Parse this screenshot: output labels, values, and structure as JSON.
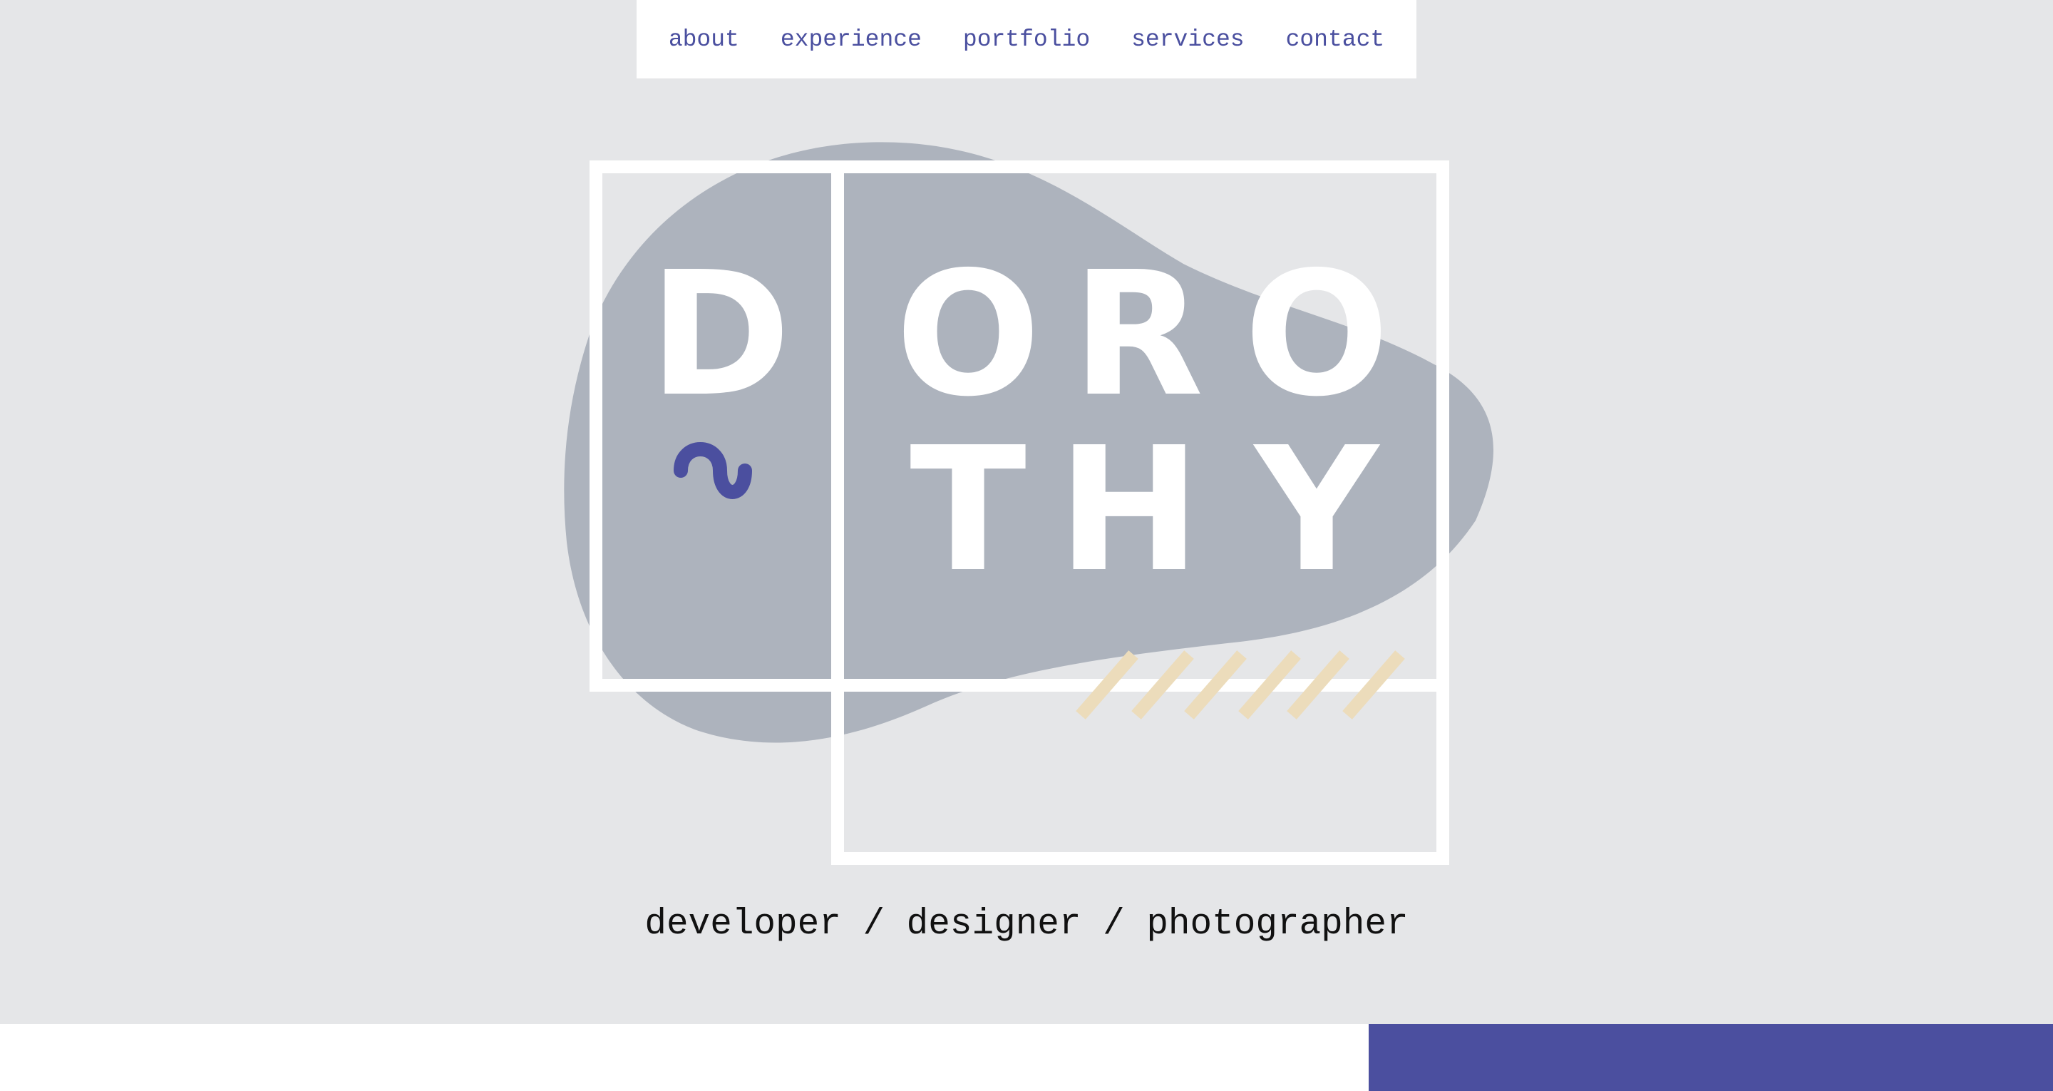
{
  "nav": {
    "items": [
      {
        "label": "about"
      },
      {
        "label": "experience"
      },
      {
        "label": "portfolio"
      },
      {
        "label": "services"
      },
      {
        "label": "contact"
      }
    ]
  },
  "logo": {
    "letters_top": [
      "D",
      "O",
      "R",
      "O"
    ],
    "letters_bottom": [
      "T",
      "H",
      "Y"
    ],
    "squiggle_icon": "tilde-squiggle-icon",
    "stripes_icon": "diagonal-stripes-icon"
  },
  "tagline": "developer / designer / photographer",
  "colors": {
    "background": "#e5e6e8",
    "nav_text": "#4a4f9f",
    "blob": "#adb3bd",
    "frame": "#ffffff",
    "squiggle": "#4b4f9f",
    "stripes": "#ecdcbb",
    "footer_accent": "#4b4f9f"
  }
}
